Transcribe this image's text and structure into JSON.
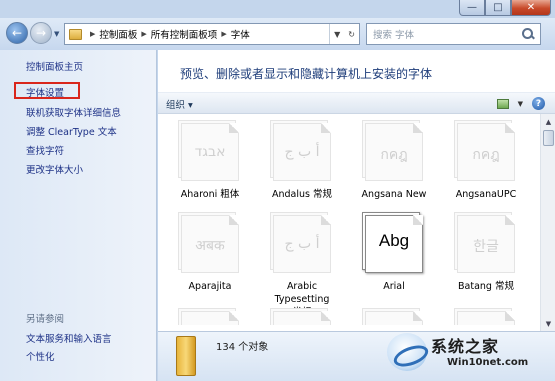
{
  "window_controls": {
    "minimize": "—",
    "maximize": "□",
    "close": "✕"
  },
  "nav": {
    "back": "←",
    "forward": "→"
  },
  "address": {
    "crumbs": [
      "控制面板",
      "所有控制面板项",
      "字体"
    ]
  },
  "search": {
    "placeholder": "搜索 字体"
  },
  "left_pane": {
    "tasks": [
      "控制面板主页",
      "字体设置",
      "联机获取字体详细信息",
      "调整 ClearType 文本",
      "查找字符",
      "更改字体大小"
    ],
    "see_also_title": "另请参阅",
    "see_also": [
      "文本服务和输入语言",
      "个性化"
    ]
  },
  "main": {
    "heading": "预览、删除或者显示和隐藏计算机上安装的字体",
    "organize_label": "组织 ▾",
    "help": "?",
    "fonts": [
      {
        "name": "Aharoni 粗体",
        "glyph": "אבגד"
      },
      {
        "name": "Andalus 常规",
        "glyph": "أ ب ج"
      },
      {
        "name": "Angsana New",
        "glyph": "กคฎ"
      },
      {
        "name": "AngsanaUPC",
        "glyph": "กคฎ"
      },
      {
        "name": "Aparajita",
        "glyph": "अबक"
      },
      {
        "name": "Arabic Typesetting 常规",
        "glyph": "أ ب ج"
      },
      {
        "name": "Arial",
        "glyph": "Abg"
      },
      {
        "name": "Batang 常规",
        "glyph": "한글"
      }
    ],
    "status_count": "134 个对象"
  },
  "watermark": {
    "title": "系统之家",
    "url": "Win10net.com"
  }
}
